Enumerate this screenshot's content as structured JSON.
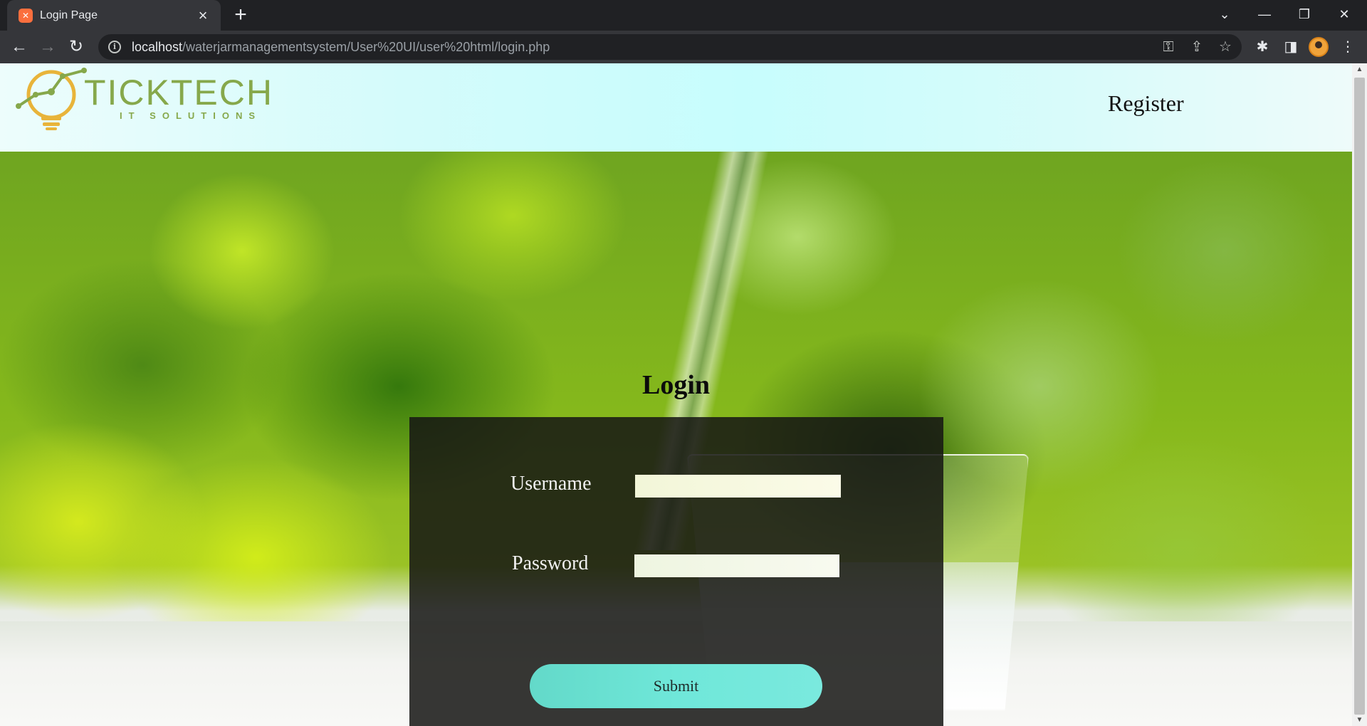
{
  "browser": {
    "tab_title": "Login Page",
    "tab_favicon": "xampp-icon",
    "url_host": "localhost",
    "url_path": "/waterjarmanagementsystem/User%20UI/user%20html/login.php"
  },
  "header": {
    "logo_text": "TICKTECH",
    "logo_tagline": "IT SOLUTIONS",
    "register_label": "Register"
  },
  "login": {
    "title": "Login",
    "username_label": "Username",
    "username_value": "",
    "password_label": "Password",
    "password_value": "",
    "submit_label": "Submit"
  },
  "colors": {
    "header_bg": "#c7fdfd",
    "logo_green": "#86a84b",
    "logo_bulb": "#e8b43a",
    "panel_bg": "#161614",
    "submit_bg": "#6fe7d9"
  }
}
